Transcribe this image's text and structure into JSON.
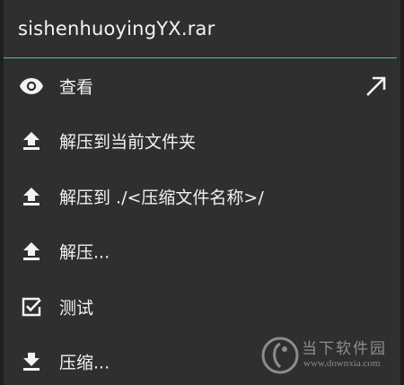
{
  "dialog": {
    "title": "sishenhuoyingYX.rar",
    "accent_color": "#4fb9c8"
  },
  "menu": {
    "items": [
      {
        "label": "查看",
        "icon": "eye-icon",
        "trailing_icon": "arrow-up-right-icon"
      },
      {
        "label": "解压到当前文件夹",
        "icon": "upload-arrow-icon"
      },
      {
        "label": "解压到 ./<压缩文件名称>/",
        "icon": "upload-arrow-icon"
      },
      {
        "label": "解压...",
        "icon": "upload-arrow-icon"
      },
      {
        "label": "测试",
        "icon": "checkbox-checked-icon"
      },
      {
        "label": "压缩...",
        "icon": "download-arrow-icon"
      }
    ]
  },
  "watermark": {
    "title": "当下软件园",
    "url": "www.downxia.com"
  }
}
